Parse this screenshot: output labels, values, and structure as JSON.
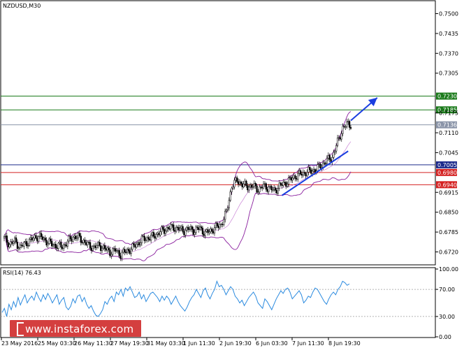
{
  "chart_data": [
    {
      "type": "candlestick",
      "title": "NZDUSD,M30",
      "ylim": [
        0.668,
        0.754
      ],
      "y_ticks": [
        "0.7500",
        "0.7435",
        "0.7370",
        "0.7305",
        "0.7175",
        "0.7110",
        "0.7045",
        "0.6915",
        "0.6850",
        "0.6785",
        "0.6720"
      ],
      "x_ticks": [
        "23 May 2016",
        "25 May 03:30",
        "26 May 11:30",
        "27 May 19:30",
        "31 May 03:30",
        "1 Jun 11:30",
        "2 Jun 19:30",
        "6 Jun 03:30",
        "7 Jun 11:30",
        "8 Jun 19:30"
      ],
      "levels": [
        {
          "value": 0.723,
          "label": "0.7230",
          "color": "#1a7a1a"
        },
        {
          "value": 0.7185,
          "label": "0.7185",
          "color": "#1a7a1a"
        },
        {
          "value": 0.7136,
          "label": "0.7136",
          "color": "#8a94a8"
        },
        {
          "value": 0.7005,
          "label": "0.7005",
          "color": "#1c2a8c"
        },
        {
          "value": 0.698,
          "label": "0.6980",
          "color": "#d42020"
        },
        {
          "value": 0.694,
          "label": "0.6940",
          "color": "#d42020"
        }
      ],
      "price_path": [
        [
          0,
          0.6765
        ],
        [
          4,
          0.6745
        ],
        [
          8,
          0.6755
        ],
        [
          12,
          0.6735
        ],
        [
          16,
          0.6748
        ],
        [
          20,
          0.6758
        ],
        [
          24,
          0.677
        ],
        [
          28,
          0.6768
        ],
        [
          32,
          0.6755
        ],
        [
          36,
          0.6745
        ],
        [
          40,
          0.674
        ],
        [
          44,
          0.6738
        ],
        [
          48,
          0.6752
        ],
        [
          52,
          0.677
        ],
        [
          56,
          0.6768
        ],
        [
          60,
          0.6755
        ],
        [
          64,
          0.674
        ],
        [
          68,
          0.6735
        ],
        [
          72,
          0.6742
        ],
        [
          76,
          0.673
        ],
        [
          80,
          0.672
        ],
        [
          84,
          0.6725
        ],
        [
          88,
          0.6712
        ],
        [
          92,
          0.6722
        ],
        [
          96,
          0.673
        ],
        [
          100,
          0.6745
        ],
        [
          104,
          0.676
        ],
        [
          108,
          0.6765
        ],
        [
          112,
          0.677
        ],
        [
          116,
          0.678
        ],
        [
          120,
          0.679
        ],
        [
          124,
          0.6798
        ],
        [
          128,
          0.68
        ],
        [
          132,
          0.6795
        ],
        [
          136,
          0.679
        ],
        [
          140,
          0.6795
        ],
        [
          144,
          0.679
        ],
        [
          148,
          0.6798
        ],
        [
          152,
          0.678
        ],
        [
          156,
          0.679
        ],
        [
          160,
          0.68
        ],
        [
          164,
          0.681
        ],
        [
          168,
          0.685
        ],
        [
          172,
          0.6935
        ],
        [
          176,
          0.6955
        ],
        [
          180,
          0.694
        ],
        [
          184,
          0.6935
        ],
        [
          188,
          0.6935
        ],
        [
          192,
          0.6925
        ],
        [
          196,
          0.6935
        ],
        [
          200,
          0.693
        ],
        [
          204,
          0.692
        ],
        [
          208,
          0.6935
        ],
        [
          212,
          0.6945
        ],
        [
          216,
          0.6955
        ],
        [
          220,
          0.6968
        ],
        [
          224,
          0.6975
        ],
        [
          228,
          0.698
        ],
        [
          232,
          0.6985
        ],
        [
          236,
          0.699
        ],
        [
          240,
          0.7005
        ],
        [
          244,
          0.702
        ],
        [
          248,
          0.703
        ],
        [
          252,
          0.708
        ],
        [
          256,
          0.7125
        ],
        [
          260,
          0.714
        ],
        [
          262,
          0.7136
        ]
      ],
      "bands": true,
      "annotations": [
        {
          "type": "trendline",
          "from": [
            210,
            0.6905
          ],
          "to": [
            260,
            0.705
          ],
          "color": "#1a3ee0"
        },
        {
          "type": "arrow",
          "from": [
            262,
            0.715
          ],
          "to": [
            282,
            0.7225
          ],
          "color": "#1a3ee0"
        }
      ]
    },
    {
      "type": "line",
      "title": "RSI(14) 76.43",
      "ylim": [
        0,
        100
      ],
      "y_ticks": [
        "100.00",
        "70.00",
        "30.00",
        "0.00"
      ],
      "levels": [
        70,
        30
      ],
      "color": "#2a8adf",
      "values": [
        36,
        42,
        30,
        48,
        40,
        52,
        44,
        58,
        47,
        55,
        62,
        50,
        56,
        60,
        54,
        66,
        58,
        52,
        62,
        55,
        64,
        58,
        50,
        56,
        62,
        48,
        54,
        58,
        44,
        40,
        45,
        56,
        50,
        60,
        62,
        52,
        58,
        48,
        42,
        46,
        38,
        32,
        30,
        34,
        40,
        52,
        48,
        56,
        60,
        52,
        66,
        62,
        70,
        60,
        72,
        68,
        74,
        66,
        58,
        60,
        66,
        56,
        62,
        52,
        58,
        64,
        66,
        62,
        58,
        52,
        60,
        54,
        60,
        56,
        48,
        54,
        60,
        52,
        46,
        42,
        38,
        44,
        52,
        58,
        62,
        70,
        64,
        58,
        68,
        72,
        62,
        56,
        64,
        70,
        82,
        74,
        76,
        70,
        62,
        68,
        74,
        70,
        60,
        56,
        50,
        54,
        46,
        52,
        58,
        62,
        66,
        60,
        50,
        46,
        42,
        56,
        52,
        46,
        40,
        48,
        56,
        62,
        68,
        64,
        70,
        72,
        66,
        56,
        60,
        64,
        68,
        62,
        50,
        54,
        60,
        58,
        66,
        72,
        70,
        64,
        58,
        52,
        48,
        56,
        62,
        66,
        62,
        70,
        74,
        82,
        80,
        76,
        78
      ]
    }
  ],
  "watermark": {
    "text": "www.instaforex.com"
  }
}
